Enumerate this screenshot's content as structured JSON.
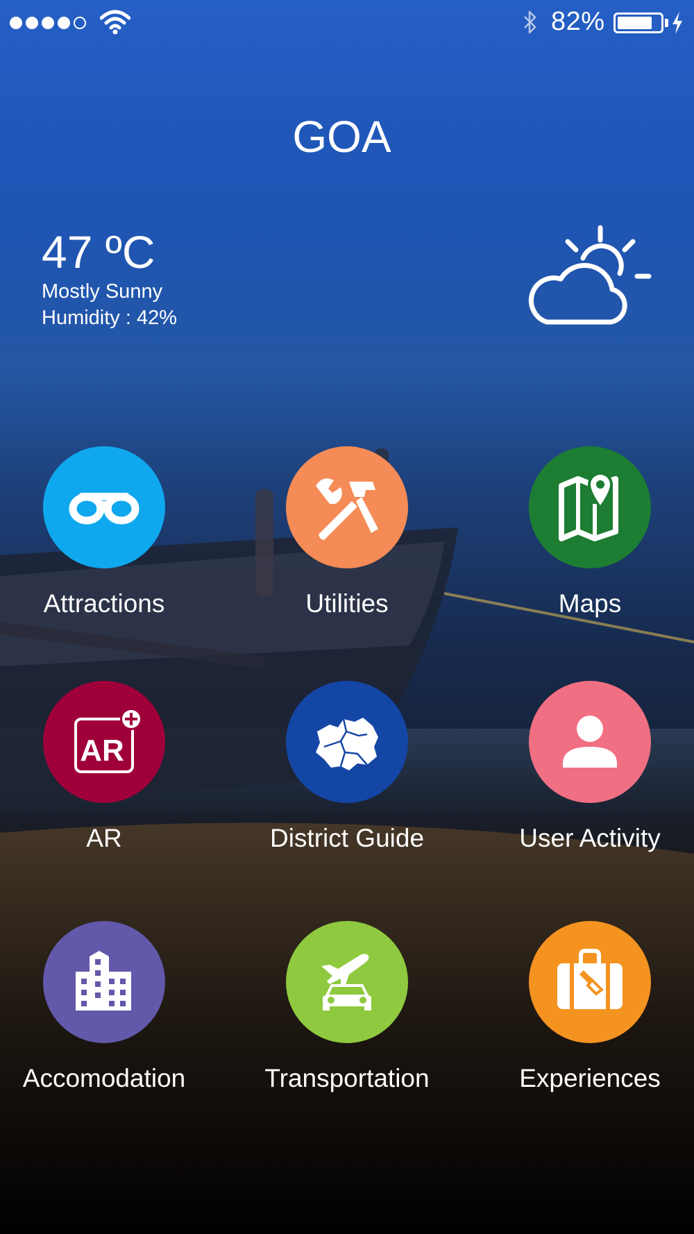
{
  "status_bar": {
    "signal_dots": [
      true,
      true,
      true,
      true,
      false
    ],
    "battery_percent": "82%",
    "battery_level": 0.82,
    "icons": [
      "wifi-icon",
      "bluetooth-icon",
      "battery-icon",
      "charging-icon"
    ]
  },
  "header": {
    "city": "GOA"
  },
  "weather": {
    "temperature": "47 ºC",
    "condition": "Mostly Sunny",
    "humidity": "Humidity : 42%",
    "icon": "partly-sunny-icon"
  },
  "menu": [
    {
      "label": "Attractions",
      "icon": "binoculars-icon",
      "color": "#0fa8ee"
    },
    {
      "label": "Utilities",
      "icon": "tools-icon",
      "color": "#f58b56"
    },
    {
      "label": "Maps",
      "icon": "map-icon",
      "color": "#1c7d33"
    },
    {
      "label": "AR",
      "icon": "ar-icon",
      "color": "#a0003a"
    },
    {
      "label": "District Guide",
      "icon": "district-map-icon",
      "color": "#1446a6"
    },
    {
      "label": "User Activity",
      "icon": "user-icon",
      "color": "#f16f82"
    },
    {
      "label": "Accomodation",
      "icon": "building-icon",
      "color": "#6259ab"
    },
    {
      "label": "Transportation",
      "icon": "transport-icon",
      "color": "#8ec93f"
    },
    {
      "label": "Experiences",
      "icon": "suitcase-icon",
      "color": "#f59320"
    }
  ]
}
